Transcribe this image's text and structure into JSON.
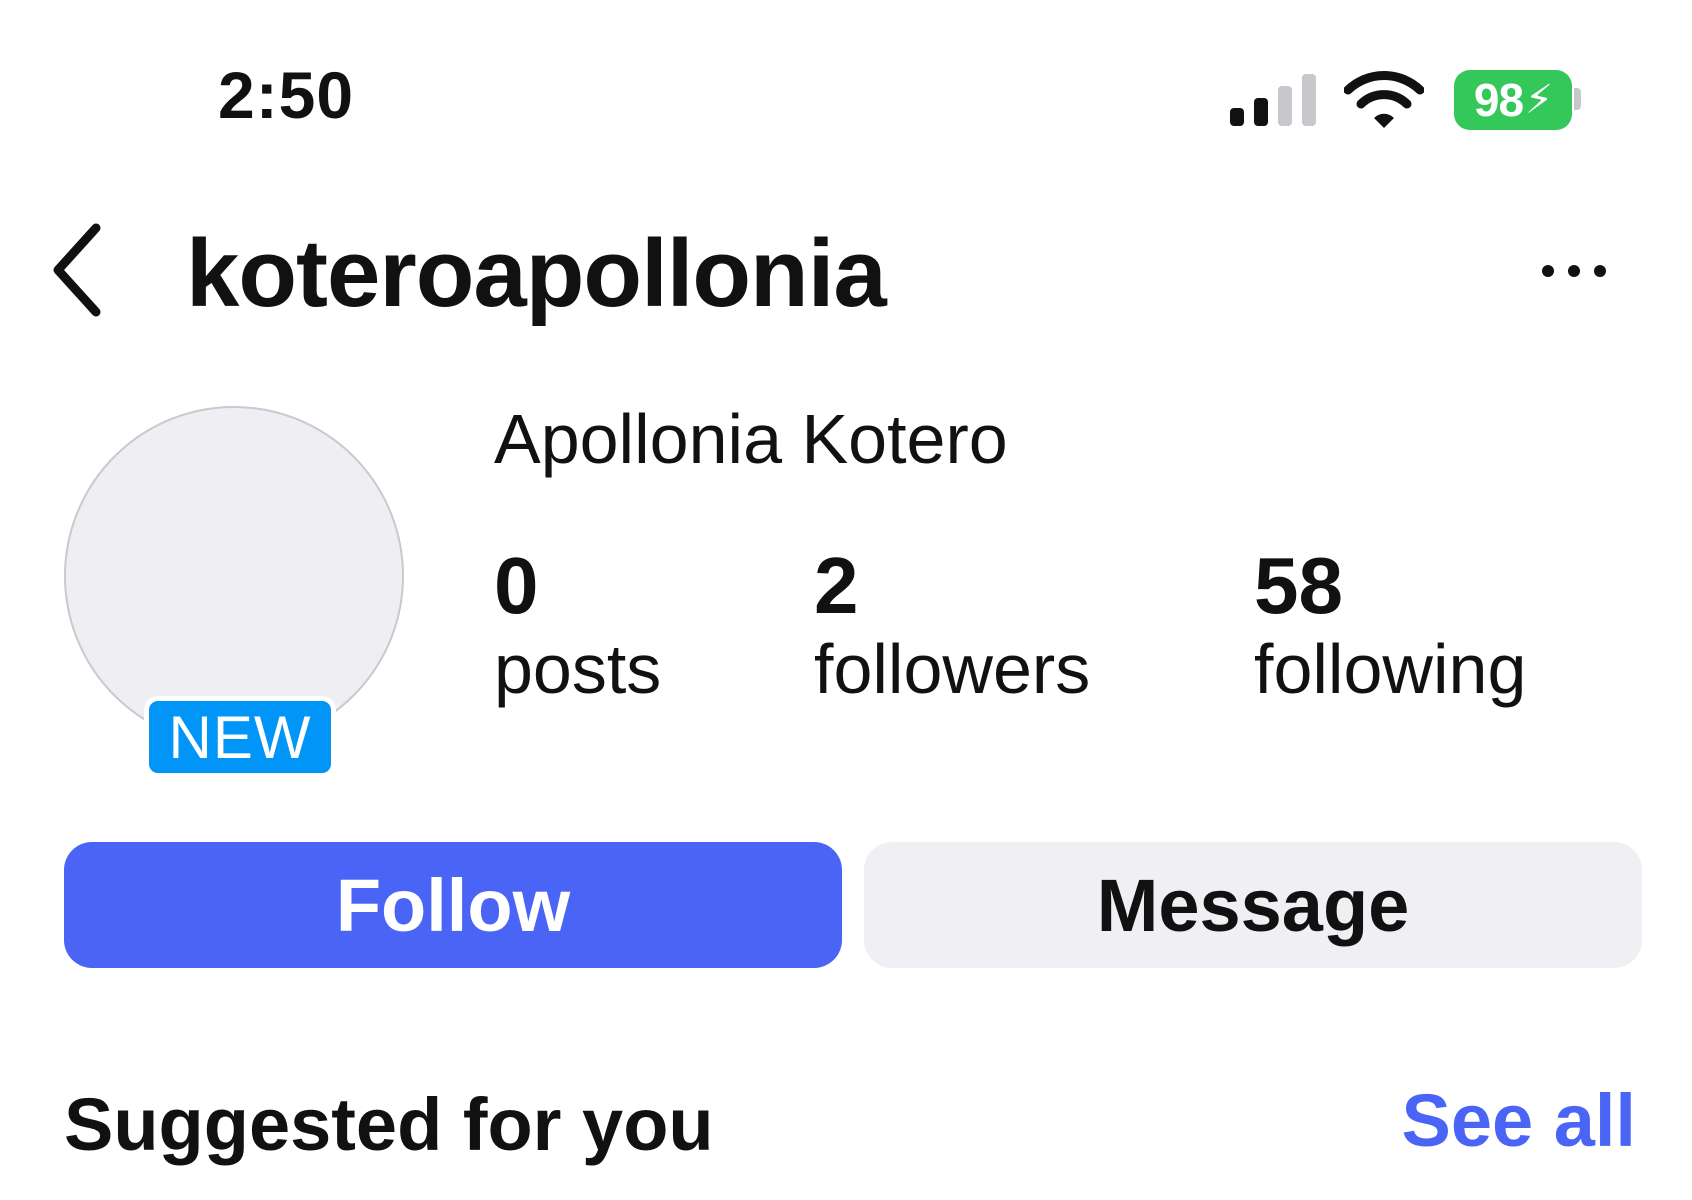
{
  "status_bar": {
    "time": "2:50",
    "battery_percent": "98",
    "signal_bars_active": 2,
    "signal_bars_total": 4,
    "battery_color": "#34c759",
    "icons": [
      "signal-icon",
      "wifi-icon",
      "battery-charging-icon"
    ]
  },
  "header": {
    "username": "koteroapollonia",
    "icons": [
      "back-chevron-icon",
      "more-options-icon"
    ]
  },
  "profile": {
    "full_name": "Apollonia Kotero",
    "badge": "NEW",
    "badge_color": "#0095f6",
    "stats": {
      "posts_count": "0",
      "posts_label": "posts",
      "followers_count": "2",
      "followers_label": "followers",
      "following_count": "58",
      "following_label": "following"
    }
  },
  "actions": {
    "follow_label": "Follow",
    "message_label": "Message",
    "follow_color": "#4a65f6"
  },
  "suggested": {
    "title": "Suggested for you",
    "see_all_label": "See all"
  }
}
